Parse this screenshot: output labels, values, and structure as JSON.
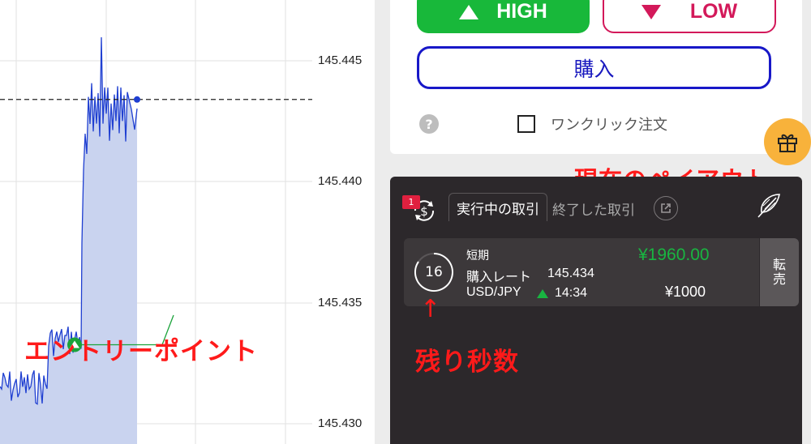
{
  "chart": {
    "price_labels": [
      "145.445",
      "145.440",
      "145.435",
      "145.430"
    ],
    "current_price": 145.4434,
    "entry_price": 145.434,
    "colors": {
      "line": "#1f3fd1",
      "fill": "#c9d3ef",
      "entry": "#1aa33a"
    }
  },
  "trade": {
    "high_label": "HIGH",
    "low_label": "LOW",
    "buy_label": "購入",
    "help_icon": "?",
    "oneclick_label": "ワンクリック注文",
    "colors": {
      "high": "#18b83a",
      "low": "#d3195a",
      "buy": "#1818c8"
    }
  },
  "positions": {
    "badge_count": "1",
    "tab_active": "実行中の取引",
    "tab_inactive": "終了した取引",
    "item": {
      "type": "短期",
      "rate_label": "購入レート",
      "rate_value": "145.434",
      "pair": "USD/JPY",
      "expiry": "14:34",
      "payout": "¥1960.00",
      "amount": "¥1000",
      "remaining_seconds": "16",
      "resell_label": "転\n売"
    }
  },
  "annotations": {
    "entry_point": "エントリーポイント",
    "current_payout": "現在のペイアウト",
    "remaining_seconds": "残り秒数",
    "arrow_down": "↓",
    "arrow_up": "↑"
  }
}
